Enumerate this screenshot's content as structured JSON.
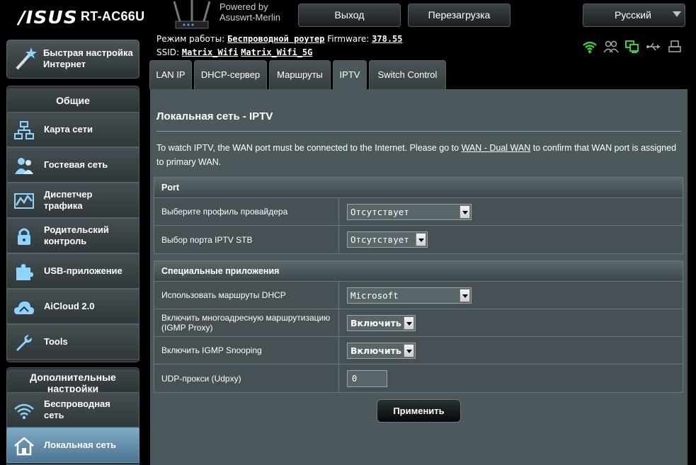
{
  "header": {
    "logo": "/ISUS",
    "model": "RT-AC66U",
    "powered_by_line1": "Powered by",
    "powered_by_line2": "Asuswrt-Merlin",
    "logout_label": "Выход",
    "reboot_label": "Перезагрузка",
    "language_label": "Русский"
  },
  "status": {
    "mode_label": "Режим работы:",
    "mode_value": "Беспроводной роутер",
    "firmware_label": "Firmware:",
    "firmware_value": "378.55",
    "ssid_label": "SSID:",
    "ssid_1": "Matrix_Wifi",
    "ssid_2": "Matrix_Wifi_5G",
    "icons": [
      "wifi-status-icon",
      "clients-icon",
      "network-map-icon",
      "usb-icon",
      "printer-icon"
    ]
  },
  "sidebar": {
    "quick_setup_line1": "Быстрая настройка",
    "quick_setup_line2": "Интернет",
    "general_header": "Общие",
    "items": [
      {
        "label": "Карта сети",
        "icon": "network-map-icon"
      },
      {
        "label": "Гостевая сеть",
        "icon": "guest-network-icon"
      },
      {
        "label": "Диспетчер трафика",
        "icon": "traffic-manager-icon"
      },
      {
        "label": "Родительский контроль",
        "icon": "lock-icon"
      },
      {
        "label": "USB-приложение",
        "icon": "puzzle-icon"
      },
      {
        "label": "AiCloud 2.0",
        "icon": "cloud-icon"
      },
      {
        "label": "Tools",
        "icon": "wrench-icon"
      }
    ],
    "advanced_header": "Дополнительные настройки",
    "advanced_items": [
      {
        "label": "Беспроводная сеть",
        "icon": "wifi-icon"
      },
      {
        "label": "Локальная сеть",
        "icon": "home-icon",
        "active": true
      }
    ]
  },
  "tabs": [
    {
      "label": "LAN IP"
    },
    {
      "label": "DHCP-сервер"
    },
    {
      "label": "Маршруты"
    },
    {
      "label": "IPTV",
      "active": true
    },
    {
      "label": "Switch Control"
    }
  ],
  "page": {
    "title": "Локальная сеть - IPTV",
    "desc_before": "To watch IPTV, the WAN port must be connected to the Internet. Please go to ",
    "desc_link": "WAN - Dual WAN",
    "desc_after": " to confirm that WAN port is assigned to primary WAN."
  },
  "port_section": {
    "header": "Port",
    "rows": [
      {
        "label": "Выберите профиль провайдера",
        "value": "Отсутствует"
      },
      {
        "label": "Выбор порта IPTV STB",
        "value": "Отсутствует"
      }
    ]
  },
  "special_section": {
    "header": "Специальные приложения",
    "rows": [
      {
        "label": "Использовать маршруты DHCP",
        "value": "Microsoft"
      },
      {
        "label": "Включить многоадресную маршрутизацию (IGMP Proxy)",
        "value": "Включить"
      },
      {
        "label": "Включить IGMP Snooping",
        "value": "Включить"
      },
      {
        "label": "UDP-прокси (Udpxy)",
        "value": "0"
      }
    ]
  },
  "apply_label": "Применить",
  "colors": {
    "accent_green": "#3ccf3c",
    "active_nav": "#6e9cb9",
    "panel": "#4d585d"
  }
}
